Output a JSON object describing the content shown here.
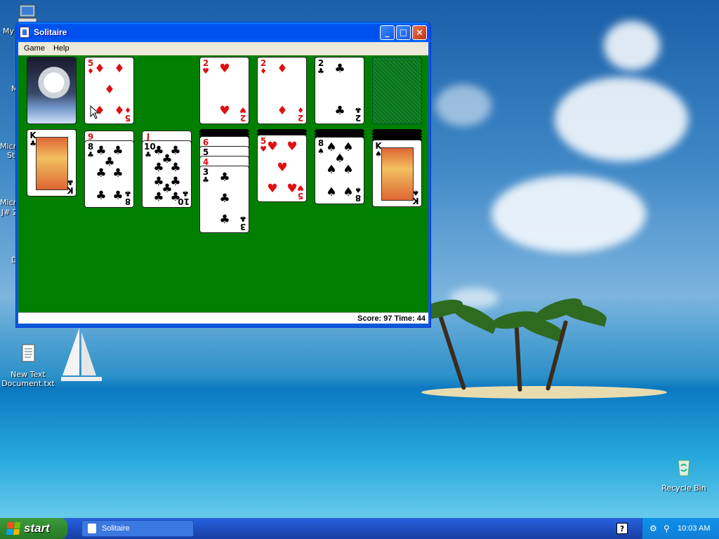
{
  "desktop": {
    "icons": [
      {
        "name": "my-computer-icon",
        "label": "My"
      },
      {
        "name": "text-document-icon",
        "label": "New Text Document.txt"
      },
      {
        "name": "recycle-bin-icon",
        "label": "Recycle Bin"
      }
    ],
    "partial_labels": [
      "M",
      "Micro",
      "Stu",
      "Micro",
      "J# 2",
      "D"
    ]
  },
  "window": {
    "title": "Solitaire",
    "buttons": {
      "minimize": "_",
      "maximize": "□",
      "close": "×"
    },
    "menu": [
      "Game",
      "Help"
    ],
    "status": "Score: 97 Time: 44"
  },
  "game": {
    "stock": "face-down",
    "waste": {
      "rank": "5",
      "suit": "♦"
    },
    "foundations": [
      {
        "rank": "2",
        "suit": "♥"
      },
      {
        "rank": "2",
        "suit": "♦"
      },
      {
        "rank": "2",
        "suit": "♣"
      },
      {
        "state": "empty"
      }
    ],
    "tableau": [
      {
        "cards": [
          {
            "rank": "K",
            "suit": "♣"
          }
        ]
      },
      {
        "cards": [
          {
            "rank": "9",
            "suit": "♦"
          },
          {
            "rank": "8",
            "suit": "♣"
          }
        ]
      },
      {
        "cards": [
          {
            "rank": "J",
            "suit": "♦"
          },
          {
            "rank": "10",
            "suit": "♣"
          }
        ]
      },
      {
        "cards": [
          {
            "rank": "6",
            "suit": "♦"
          },
          {
            "rank": "5",
            "suit": "♣"
          },
          {
            "rank": "4",
            "suit": "♥"
          },
          {
            "rank": "3",
            "suit": "♣"
          }
        ]
      },
      {
        "cards": [
          {
            "rank": "5",
            "suit": "♥"
          }
        ]
      },
      {
        "cards": [
          {
            "rank": "8",
            "suit": "♠"
          }
        ]
      },
      {
        "cards": [
          {
            "rank": "K",
            "suit": "♠"
          }
        ]
      }
    ]
  },
  "taskbar": {
    "start": "start",
    "task": "Solitaire",
    "help": "?",
    "clock": "10:03 AM"
  }
}
